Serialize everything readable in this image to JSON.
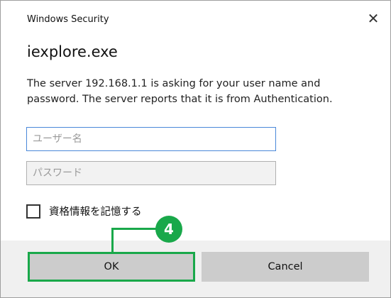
{
  "window": {
    "title": "Windows Security",
    "close_glyph": "✕"
  },
  "app_name": "iexplore.exe",
  "message": "The server 192.168.1.1 is asking for your user name and password. The server reports that it is from Authentication.",
  "username_field": {
    "value": "",
    "placeholder": "ユーザー名"
  },
  "password_field": {
    "value": "",
    "placeholder": "パスワード"
  },
  "remember": {
    "label": "資格情報を記憶する",
    "checked": false
  },
  "buttons": {
    "ok": "OK",
    "cancel": "Cancel"
  },
  "callout": {
    "number": "4",
    "color": "#19a84a"
  },
  "colors": {
    "focus_border": "#4a88d9",
    "button_bg": "#cccccc",
    "footer_bg": "#f0f0f0"
  }
}
